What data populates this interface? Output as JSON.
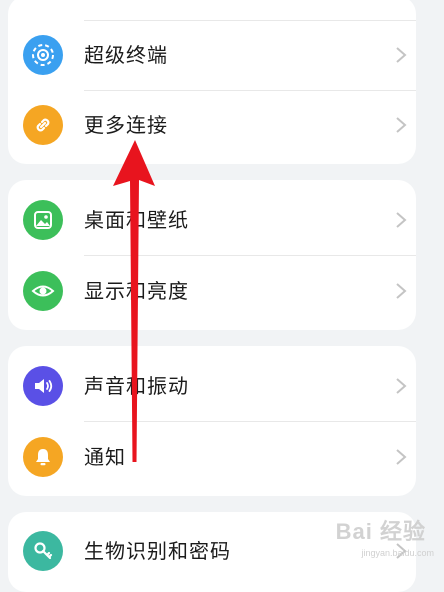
{
  "groups": [
    {
      "items": [
        {
          "label": "超级终端",
          "icon": "super-device-icon",
          "color": "#3aa0f0"
        },
        {
          "label": "更多连接",
          "icon": "link-icon",
          "color": "#f5a623"
        }
      ]
    },
    {
      "items": [
        {
          "label": "桌面和壁纸",
          "icon": "wallpaper-icon",
          "color": "#3cbf5a"
        },
        {
          "label": "显示和亮度",
          "icon": "eye-icon",
          "color": "#3cbf5a"
        }
      ]
    },
    {
      "items": [
        {
          "label": "声音和振动",
          "icon": "speaker-icon",
          "color": "#5a50e6"
        },
        {
          "label": "通知",
          "icon": "bell-icon",
          "color": "#f5a623"
        }
      ]
    },
    {
      "items": [
        {
          "label": "生物识别和密码",
          "icon": "key-icon",
          "color": "#3cb8a0"
        }
      ]
    }
  ],
  "annotation": {
    "arrow_color": "#e8141e"
  },
  "watermark": {
    "logo": "Bai 经验",
    "url": "jingyan.baidu.com"
  }
}
